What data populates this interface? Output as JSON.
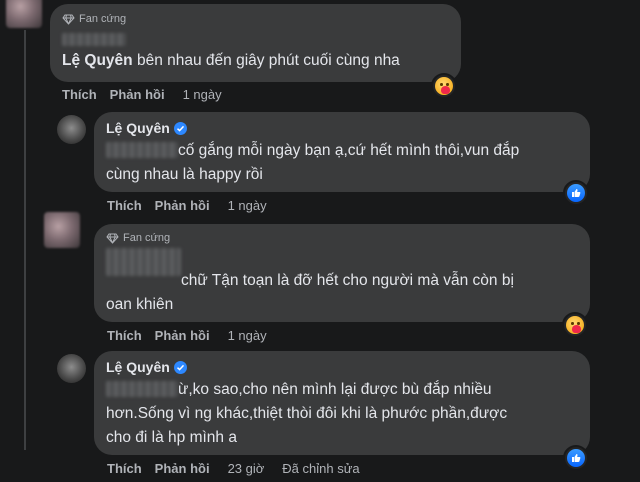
{
  "comments": [
    {
      "badge": "Fan cứng",
      "mention": "Lệ Quyên",
      "text": " bên nhau đến giây phút cuối cùng nha",
      "like": "Thích",
      "reply": "Phản hồi",
      "time": "1 ngày"
    },
    {
      "author": "Lệ Quyên",
      "line1": " cố gắng mỗi ngày bạn ạ,cứ hết mình thôi,vun đắp",
      "line2": "cùng nhau là happy rồi",
      "like": "Thích",
      "reply": "Phản hồi",
      "time": "1 ngày"
    },
    {
      "badge": "Fan cứng",
      "line1": " chữ Tận toạn là đỡ hết cho người mà vẫn còn bị",
      "line2": "oan khiên",
      "like": "Thích",
      "reply": "Phản hồi",
      "time": "1 ngày"
    },
    {
      "author": "Lệ Quyên",
      "line1": " ừ,ko sao,cho nên mình lại được bù đắp nhiều",
      "line2": "hơn.Sống vì ng khác,thiệt thòi đôi khi là phước phần,được",
      "line3": "cho đi là hp mình a",
      "like": "Thích",
      "reply": "Phản hồi",
      "time": "23 giờ",
      "edited": "Đã chỉnh sửa"
    }
  ],
  "reactions": {
    "care": "care-reaction",
    "like": "like-reaction"
  },
  "colors": {
    "background": "#18191a",
    "bubble": "#3a3b3c",
    "text": "#e4e6eb",
    "muted": "#b0b3b8",
    "verified": "#2d88ff"
  }
}
